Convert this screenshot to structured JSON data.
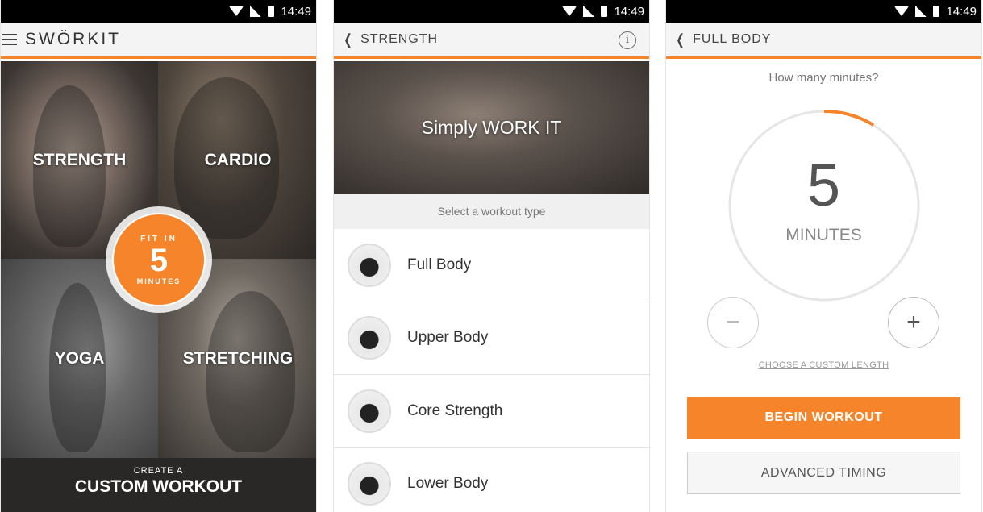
{
  "status_bar": {
    "time": "14:49"
  },
  "screen1": {
    "logo": "SWÖRKIT",
    "tiles": [
      "STRENGTH",
      "CARDIO",
      "YOGA",
      "STRETCHING"
    ],
    "badge": {
      "top": "FIT IN",
      "number": "5",
      "bottom": "MINUTES"
    },
    "custom": {
      "small": "CREATE A",
      "big": "CUSTOM WORKOUT"
    }
  },
  "screen2": {
    "title": "STRENGTH",
    "hero_text": "Simply WORK IT",
    "prompt": "Select a workout type",
    "items": [
      "Full Body",
      "Upper Body",
      "Core Strength",
      "Lower Body"
    ]
  },
  "screen3": {
    "title": "FULL BODY",
    "question": "How many minutes?",
    "minutes": "5",
    "unit": "MINUTES",
    "minus": "−",
    "plus": "+",
    "custom_length": "CHOOSE A CUSTOM LENGTH",
    "begin": "BEGIN WORKOUT",
    "advanced": "ADVANCED TIMING"
  },
  "colors": {
    "accent": "#f5842a"
  }
}
